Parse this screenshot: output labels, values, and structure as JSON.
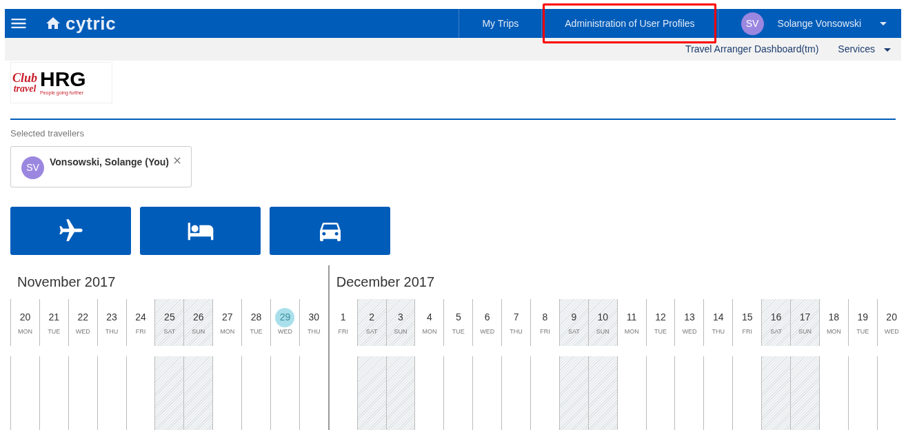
{
  "header": {
    "logo": "cytric",
    "nav": [
      {
        "label": "My Trips",
        "highlighted": false
      },
      {
        "label": "Administration of User Profiles",
        "highlighted": true
      }
    ],
    "user": {
      "initials": "SV",
      "name": "Solange Vonsowski"
    }
  },
  "subnav": [
    {
      "label": "Travel Arranger Dashboard(tm)",
      "dropdown": false
    },
    {
      "label": "Services",
      "dropdown": true
    }
  ],
  "company_logo": {
    "club": "Club",
    "travel": "travel",
    "brand": "HRG",
    "tagline": "People going further"
  },
  "travellers": {
    "label": "Selected travellers",
    "items": [
      {
        "initials": "SV",
        "name": "Vonsowski, Solange (You)"
      }
    ]
  },
  "services": [
    {
      "kind": "flight"
    },
    {
      "kind": "hotel"
    },
    {
      "kind": "car"
    }
  ],
  "calendar": {
    "months": [
      {
        "title": "November 2017",
        "days": [
          {
            "day": "20",
            "weekday": "MON",
            "weekend": false,
            "today": false
          },
          {
            "day": "21",
            "weekday": "TUE",
            "weekend": false,
            "today": false
          },
          {
            "day": "22",
            "weekday": "WED",
            "weekend": false,
            "today": false
          },
          {
            "day": "23",
            "weekday": "THU",
            "weekend": false,
            "today": false
          },
          {
            "day": "24",
            "weekday": "FRI",
            "weekend": false,
            "today": false
          },
          {
            "day": "25",
            "weekday": "SAT",
            "weekend": true,
            "today": false
          },
          {
            "day": "26",
            "weekday": "SUN",
            "weekend": true,
            "today": false
          },
          {
            "day": "27",
            "weekday": "MON",
            "weekend": false,
            "today": false
          },
          {
            "day": "28",
            "weekday": "TUE",
            "weekend": false,
            "today": false
          },
          {
            "day": "29",
            "weekday": "WED",
            "weekend": false,
            "today": true
          },
          {
            "day": "30",
            "weekday": "THU",
            "weekend": false,
            "today": false
          }
        ]
      },
      {
        "title": "December 2017",
        "days": [
          {
            "day": "1",
            "weekday": "FRI",
            "weekend": false,
            "today": false
          },
          {
            "day": "2",
            "weekday": "SAT",
            "weekend": true,
            "today": false
          },
          {
            "day": "3",
            "weekday": "SUN",
            "weekend": true,
            "today": false
          },
          {
            "day": "4",
            "weekday": "MON",
            "weekend": false,
            "today": false
          },
          {
            "day": "5",
            "weekday": "TUE",
            "weekend": false,
            "today": false
          },
          {
            "day": "6",
            "weekday": "WED",
            "weekend": false,
            "today": false
          },
          {
            "day": "7",
            "weekday": "THU",
            "weekend": false,
            "today": false
          },
          {
            "day": "8",
            "weekday": "FRI",
            "weekend": false,
            "today": false
          },
          {
            "day": "9",
            "weekday": "SAT",
            "weekend": true,
            "today": false
          },
          {
            "day": "10",
            "weekday": "SUN",
            "weekend": true,
            "today": false
          },
          {
            "day": "11",
            "weekday": "MON",
            "weekend": false,
            "today": false
          },
          {
            "day": "12",
            "weekday": "TUE",
            "weekend": false,
            "today": false
          },
          {
            "day": "13",
            "weekday": "WED",
            "weekend": false,
            "today": false
          },
          {
            "day": "14",
            "weekday": "THU",
            "weekend": false,
            "today": false
          },
          {
            "day": "15",
            "weekday": "FRI",
            "weekend": false,
            "today": false
          },
          {
            "day": "16",
            "weekday": "SAT",
            "weekend": true,
            "today": false
          },
          {
            "day": "17",
            "weekday": "SUN",
            "weekend": true,
            "today": false
          },
          {
            "day": "18",
            "weekday": "MON",
            "weekend": false,
            "today": false
          },
          {
            "day": "19",
            "weekday": "TUE",
            "weekend": false,
            "today": false
          },
          {
            "day": "20",
            "weekday": "WED",
            "weekend": false,
            "today": false
          }
        ]
      }
    ]
  }
}
